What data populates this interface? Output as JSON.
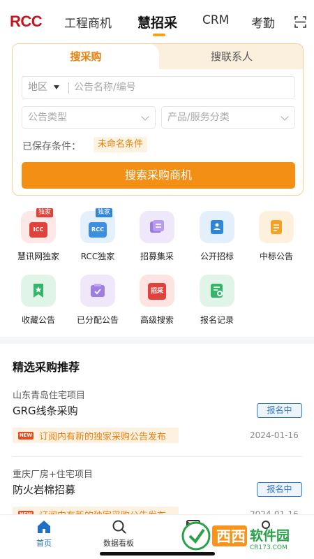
{
  "header": {
    "logo": "RCC",
    "tabs": [
      {
        "label": "工程商机"
      },
      {
        "label": "慧招采"
      },
      {
        "label": "CRM"
      },
      {
        "label": "考勤"
      }
    ]
  },
  "search_card": {
    "tabs": [
      {
        "label": "搜采购"
      },
      {
        "label": "搜联系人"
      }
    ],
    "region_label": "地区",
    "keyword_placeholder": "公告名称/编号",
    "type_placeholder": "公告类型",
    "category_placeholder": "产品/服务分类",
    "saved_label": "已保存条件：",
    "saved_chip": "未命名条件",
    "search_button": "搜索采购商机"
  },
  "grid": {
    "items": [
      {
        "label": "慧讯网独家",
        "badge": "独家",
        "inner_text": "ICC"
      },
      {
        "label": "RCC独家",
        "badge": "独家",
        "inner_text": "RCC"
      },
      {
        "label": "招募集采"
      },
      {
        "label": "公开招标"
      },
      {
        "label": "中标公告"
      },
      {
        "label": "收藏公告"
      },
      {
        "label": "已分配公告"
      },
      {
        "label": "高级搜索",
        "inner_text": "招采"
      },
      {
        "label": "报名记录"
      }
    ]
  },
  "recommend": {
    "title": "精选采购推荐",
    "items": [
      {
        "project": "山东青岛住宅项目",
        "name": "GRG线条采购",
        "status": "报名中",
        "new_tag": "NEW",
        "notice": "订阅内有新的独家采购公告发布",
        "date": "2024-01-16"
      },
      {
        "project": "重庆厂房+住宅项目",
        "name": "防火岩棉招募",
        "status": "报名中",
        "new_tag": "NEW",
        "notice": "订阅内有新的独家采购公告发布",
        "date": "2024-01-16"
      }
    ]
  },
  "bottom_nav": {
    "items": [
      {
        "label": "首页"
      },
      {
        "label": "数据看板"
      },
      {
        "label": "消"
      }
    ]
  },
  "watermark": {
    "main": "西西软件园",
    "sub": "CR173.COM"
  },
  "colors": {
    "accent": "#f48f16",
    "brand_red": "#c8141e",
    "link_blue": "#2f78c2"
  }
}
